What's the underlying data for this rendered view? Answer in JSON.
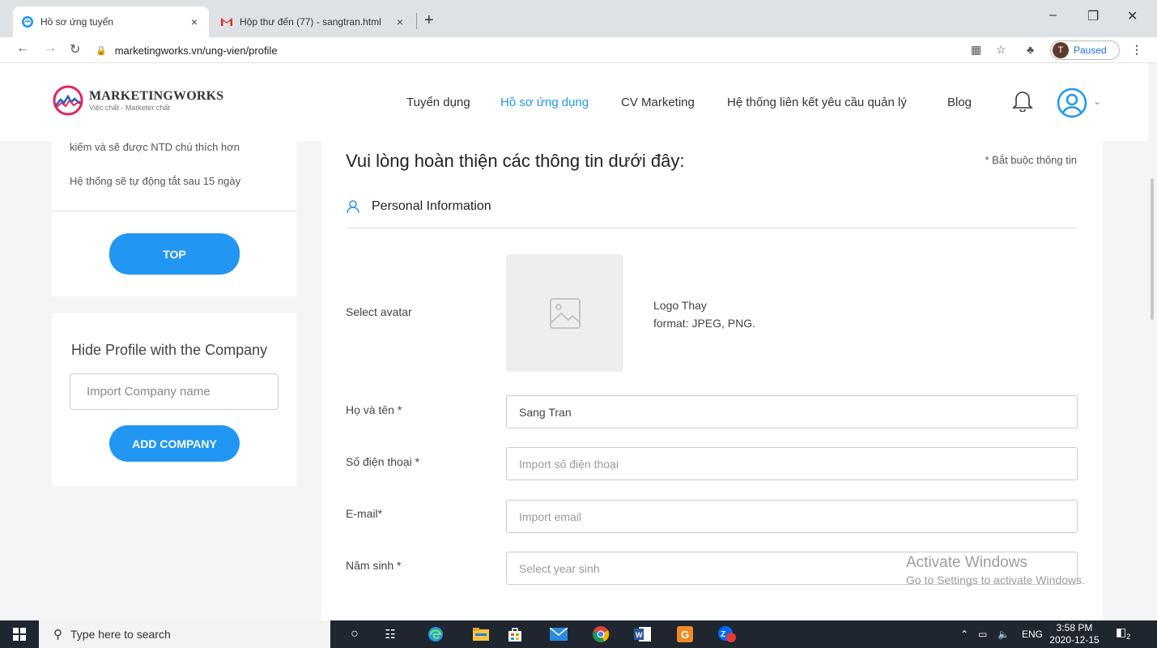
{
  "browser": {
    "tabs": [
      {
        "title": "Hồ sơ ứng tuyển",
        "close": "×"
      },
      {
        "title": "Hộp thư đến (77) - sangtran.html",
        "close": "×"
      }
    ],
    "new_tab": "+",
    "url": "marketingworks.vn/ung-vien/profile",
    "profile_initial": "T",
    "profile_status": "Paused"
  },
  "site": {
    "brand": "MARKETINGWORKS",
    "slogan": "Việc chất - Marketer chất",
    "nav": [
      "Tuyển dụng",
      "Hồ sơ ứng dụng",
      "CV Marketing",
      "Hệ thống liên kết yêu cầu quản lý",
      "Blog"
    ],
    "active_nav": "Hồ sơ ứng dụng"
  },
  "sidebar": {
    "card1_line1": "kiếm và sẽ được NTD chú thích hơn",
    "card1_line2": "Hệ thống sẽ tự động tắt sau 15 ngày",
    "top_button": "TOP",
    "hide_title": "Hide Profile with the Company",
    "company_placeholder": "Import Company name",
    "add_button": "ADD COMPANY"
  },
  "form": {
    "heading": "Vui lòng hoàn thiện các thông tin dưới đây:",
    "required_note": "* Bắt buộc thông tin",
    "section_title": "Personal Information",
    "avatar_label": "Select avatar",
    "logo_note_1": "Logo Thay",
    "logo_note_2": "format: JPEG, PNG.",
    "name_label": "Họ và tên *",
    "name_value": "Sang Tran",
    "phone_label": "Số điện thoại *",
    "phone_placeholder": "Import số điện thoại",
    "email_label": "E-mail*",
    "email_placeholder": "Import email",
    "year_label": "Năm sinh *",
    "year_placeholder": "Select year sinh"
  },
  "watermark": {
    "line1": "Activate Windows",
    "line2": "Go to Settings to activate Windows."
  },
  "taskbar": {
    "search_placeholder": "Type here to search",
    "language": "ENG",
    "time": "3:58 PM",
    "date": "2020-12-15",
    "notification_count": "2"
  },
  "colors": {
    "accent": "#2196f3",
    "logo_red": "#e0245e",
    "taskbar": "#1f2630"
  }
}
